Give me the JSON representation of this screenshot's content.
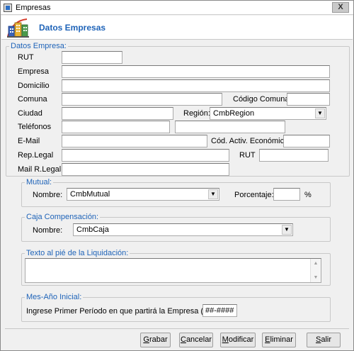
{
  "window": {
    "title": "Empresas",
    "close_symbol": "X"
  },
  "header": {
    "title": "Datos Empresas"
  },
  "datos": {
    "legend": "Datos Empresa:",
    "rut_label": "RUT",
    "empresa_label": "Empresa",
    "domicilio_label": "Domicilio",
    "comuna_label": "Comuna",
    "codigo_comuna_label": "Código Comuna",
    "ciudad_label": "Ciudad",
    "region_label": "Región:",
    "region_value": "CmbRegion",
    "telefonos_label": "Teléfonos",
    "email_label": "E-Mail",
    "cod_activ_label": "Cód. Activ. Económica",
    "rep_legal_label": "Rep.Legal",
    "rut2_label": "RUT",
    "mail_rlegal_label": "Mail R.Legal"
  },
  "mutual": {
    "legend": "Mutual:",
    "nombre_label": "Nombre:",
    "nombre_value": "CmbMutual",
    "porcentaje_label": "Porcentaje:",
    "percent_sign": "%"
  },
  "caja": {
    "legend": "Caja Compensación:",
    "nombre_label": "Nombre:",
    "nombre_value": "CmbCaja"
  },
  "texto": {
    "legend": "Texto al pié de la Liquidación:"
  },
  "mesanio": {
    "legend": "Mes-Año Inicial:",
    "prompt": "Ingrese Primer Período en que partirá la Empresa (Mes-Año)",
    "value": "##-####"
  },
  "buttons": {
    "grabar": {
      "first": "G",
      "rest": "rabar"
    },
    "cancelar": {
      "first": "C",
      "rest": "ancelar"
    },
    "modificar": {
      "first": "M",
      "rest": "odificar"
    },
    "eliminar": {
      "first": "E",
      "rest": "liminar"
    },
    "salir": {
      "first": "S",
      "rest": "alir"
    }
  }
}
